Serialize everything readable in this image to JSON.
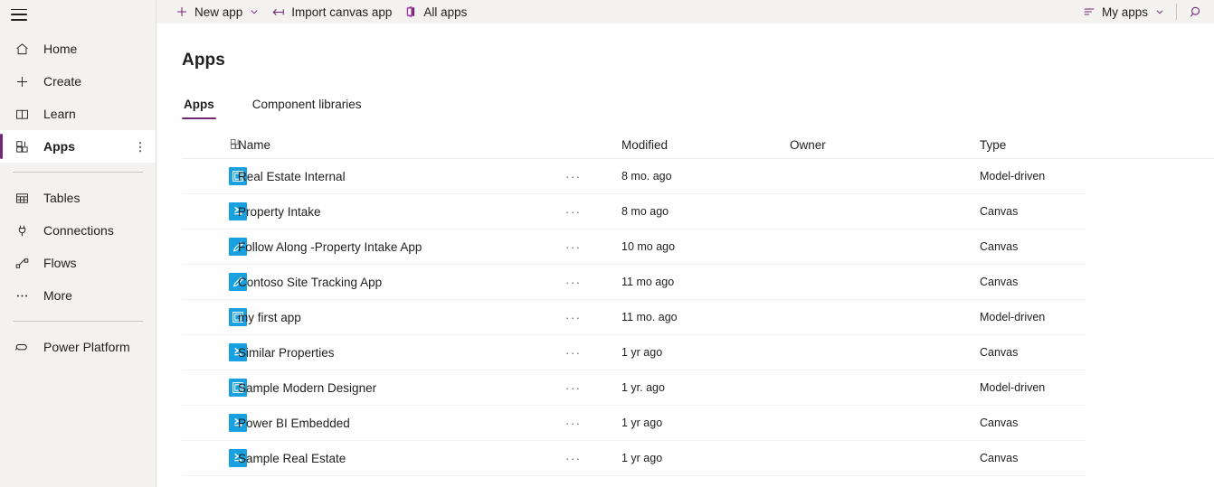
{
  "sidebar": {
    "hamburger_icon": "hamburger-menu-icon",
    "items": [
      {
        "label": "Home",
        "icon": "home-icon",
        "selected": false,
        "has_more": false
      },
      {
        "label": "Create",
        "icon": "plus-icon",
        "selected": false,
        "has_more": false
      },
      {
        "label": "Learn",
        "icon": "book-icon",
        "selected": false,
        "has_more": false
      },
      {
        "label": "Apps",
        "icon": "apps-grid-icon",
        "selected": true,
        "has_more": true
      },
      {
        "label": "Tables",
        "icon": "table-icon",
        "selected": false,
        "has_more": false
      },
      {
        "label": "Connections",
        "icon": "plug-icon",
        "selected": false,
        "has_more": false
      },
      {
        "label": "Flows",
        "icon": "flow-icon",
        "selected": false,
        "has_more": false
      },
      {
        "label": "More",
        "icon": "ellipsis-icon",
        "selected": false,
        "has_more": false
      }
    ],
    "footer_item": {
      "label": "Power Platform",
      "icon": "power-platform-icon"
    },
    "more_dots": "⋮"
  },
  "toolbar": {
    "new_app_label": "New app",
    "new_app_icon": "plus-icon",
    "new_app_chevron": "chevron-down-icon",
    "import_label": "Import canvas app",
    "import_icon": "import-arrow-icon",
    "all_apps_label": "All apps",
    "all_apps_icon": "office-apps-icon",
    "my_apps_label": "My apps",
    "my_apps_icon": "filter-list-icon",
    "my_apps_chevron": "chevron-down-icon",
    "search_icon": "search-icon"
  },
  "page": {
    "title": "Apps",
    "tabs": [
      {
        "label": "Apps",
        "active": true
      },
      {
        "label": "Component libraries",
        "active": false
      }
    ]
  },
  "table": {
    "header": {
      "icon": "apps-grid-icon",
      "name": "Name",
      "modified": "Modified",
      "owner": "Owner",
      "type": "Type"
    },
    "row_menu": "···",
    "rows": [
      {
        "name": "Real Estate Internal",
        "modified": "8 mo. ago",
        "owner": "",
        "type": "Model-driven",
        "icon": "model-driven-app-icon"
      },
      {
        "name": "Property Intake",
        "modified": "8 mo ago",
        "owner": "",
        "type": "Canvas",
        "icon": "canvas-app-icon"
      },
      {
        "name": "Follow Along -Property Intake App",
        "modified": "10 mo ago",
        "owner": "",
        "type": "Canvas",
        "icon": "pencil-app-icon"
      },
      {
        "name": "Contoso Site Tracking App",
        "modified": "11 mo ago",
        "owner": "",
        "type": "Canvas",
        "icon": "pencil-app-icon"
      },
      {
        "name": "my first app",
        "modified": "11 mo. ago",
        "owner": "",
        "type": "Model-driven",
        "icon": "model-driven-app-icon"
      },
      {
        "name": "Similar Properties",
        "modified": "1 yr ago",
        "owner": "",
        "type": "Canvas",
        "icon": "canvas-app-icon"
      },
      {
        "name": "Sample Modern Designer",
        "modified": "1 yr. ago",
        "owner": "",
        "type": "Model-driven",
        "icon": "model-driven-app-icon"
      },
      {
        "name": "Power BI Embedded",
        "modified": "1 yr ago",
        "owner": "",
        "type": "Canvas",
        "icon": "canvas-app-icon"
      },
      {
        "name": "Sample Real Estate",
        "modified": "1 yr ago",
        "owner": "",
        "type": "Canvas",
        "icon": "canvas-app-icon"
      }
    ]
  },
  "colors": {
    "accent": "#742774",
    "app_tile": "#18a0e0",
    "toolbar_bg": "#f3f2f1",
    "sidebar_bg": "#f3f2f1"
  }
}
